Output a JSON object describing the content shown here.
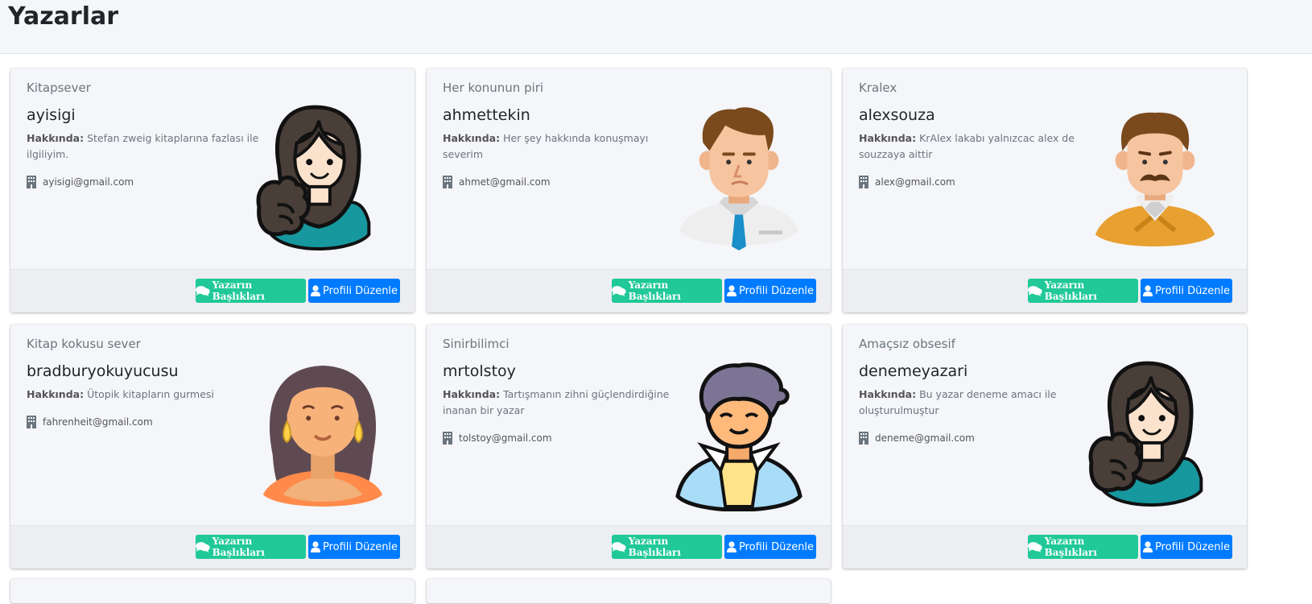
{
  "page": {
    "title": "Yazarlar"
  },
  "labels": {
    "about_prefix": "Hakkında:",
    "titles_button": "Yazarın Başlıkları",
    "edit_button": "Profili Düzenle"
  },
  "authors": [
    {
      "header": "Kitapsever",
      "username": "ayisigi",
      "about": "Stefan zweig kitaplarına fazlası ile ilgiliyim.",
      "email": "ayisigi@gmail.com",
      "avatar": "woman-dark-hair-avatar-icon"
    },
    {
      "header": "Her konunun piri",
      "username": "ahmettekin",
      "about": "Her şey hakkında konuşmayı severim",
      "email": "ahmet@gmail.com",
      "avatar": "man-tie-avatar-icon"
    },
    {
      "header": "Kralex",
      "username": "alexsouza",
      "about": "KrAlex lakabı yalnızcac alex de souzzaya aittir",
      "email": "alex@gmail.com",
      "avatar": "man-mustache-avatar-icon"
    },
    {
      "header": "Kitap kokusu sever",
      "username": "bradburyokuyucusu",
      "about": "Ütopik kitapların gurmesi",
      "email": "fahrenheit@gmail.com",
      "avatar": "woman-earrings-avatar-icon"
    },
    {
      "header": "Sinirbilimci",
      "username": "mrtolstoy",
      "about": "Tartışmanın zihni güçlendirdiğine inanan bir yazar",
      "email": "tolstoy@gmail.com",
      "avatar": "young-man-jacket-avatar-icon"
    },
    {
      "header": "Amaçsız obsesif",
      "username": "denemeyazari",
      "about": "Bu yazar deneme amacı ile oluşturulmuştur",
      "email": "deneme@gmail.com",
      "avatar": "woman-dark-hair-avatar-icon"
    }
  ]
}
